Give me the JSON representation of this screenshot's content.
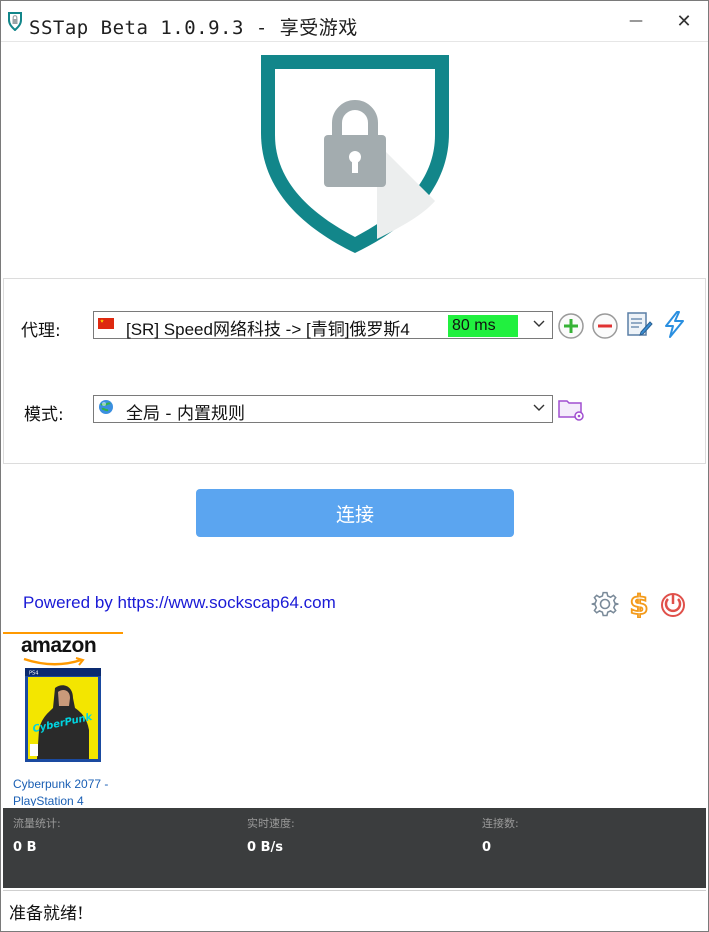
{
  "window": {
    "title": "SSTap Beta 1.0.9.3 - 享受游戏",
    "minimize_glyph": "—",
    "close_glyph": "✕"
  },
  "proxy": {
    "label": "代理:",
    "selected": "[SR] Speed网络科技 -> [青铜]俄罗斯4",
    "ping": "80 ms",
    "flag_icon": "china-flag-icon",
    "ping_color": "#21f03f"
  },
  "mode": {
    "label": "模式:",
    "selected": "全局 - 内置规则",
    "icon": "globe-icon"
  },
  "connect": {
    "label": "连接",
    "color": "#5ba5f0"
  },
  "footer": {
    "powered_prefix": "Powered by ",
    "powered_link": "https://www.sockscap64.com"
  },
  "ad": {
    "brand": "amazon",
    "product": "Cyberpunk 2077 - PlayStation 4"
  },
  "stats": {
    "traffic_label": "流量统计:",
    "traffic_value": "0 B",
    "speed_label": "实时速度:",
    "speed_value": "0 B/s",
    "connections_label": "连接数:",
    "connections_value": "0"
  },
  "status": {
    "text": "准备就绪!"
  },
  "colors": {
    "shield": "#12868a",
    "stats_bg": "#3b3d3e",
    "link": "#1a1ad6"
  }
}
